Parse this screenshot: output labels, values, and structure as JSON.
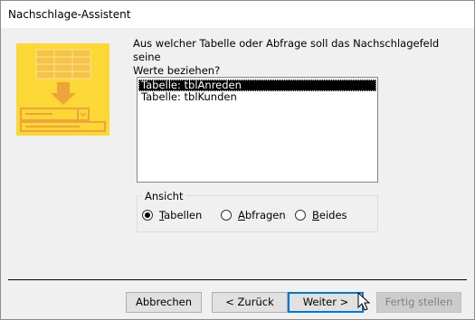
{
  "window": {
    "title": "Nachschlage-Assistent"
  },
  "prompt": {
    "text": "Aus welcher Tabelle oder Abfrage soll das Nachschlagefeld seine\nWerte beziehen?"
  },
  "list": {
    "items": [
      {
        "label": "Tabelle: tblAnreden",
        "selected": true
      },
      {
        "label": "Tabelle: tblKunden",
        "selected": false
      }
    ]
  },
  "view_group": {
    "label": "Ansicht",
    "options": [
      {
        "label": "Tabellen",
        "checked": true
      },
      {
        "label": "Abfragen",
        "checked": false
      },
      {
        "label": "Beides",
        "checked": false
      }
    ]
  },
  "buttons": {
    "cancel": "Abbrechen",
    "back": "< Zurück",
    "next": "Weiter >",
    "finish": "Fertig stellen"
  },
  "colors": {
    "illustration_yellow": "#fcd836",
    "illustration_orange": "#f5a623",
    "selection": "#000000",
    "default_button_border": "#0078d7"
  }
}
